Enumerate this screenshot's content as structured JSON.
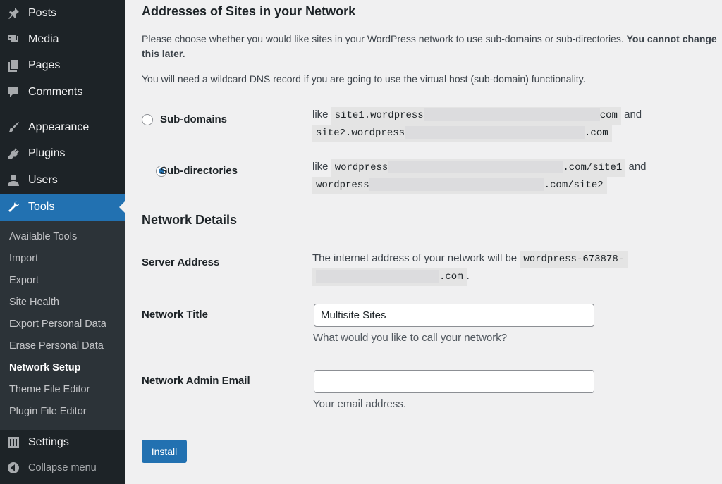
{
  "sidebar": {
    "menu": [
      {
        "label": "Posts",
        "icon": "pushpin-icon"
      },
      {
        "label": "Media",
        "icon": "media-icon"
      },
      {
        "label": "Pages",
        "icon": "pages-icon"
      },
      {
        "label": "Comments",
        "icon": "comment-icon"
      },
      {
        "label": "Appearance",
        "icon": "paintbrush-icon"
      },
      {
        "label": "Plugins",
        "icon": "plug-icon"
      },
      {
        "label": "Users",
        "icon": "user-icon"
      },
      {
        "label": "Tools",
        "icon": "wrench-icon"
      }
    ],
    "submenu": [
      "Available Tools",
      "Import",
      "Export",
      "Site Health",
      "Export Personal Data",
      "Erase Personal Data",
      "Network Setup",
      "Theme File Editor",
      "Plugin File Editor"
    ],
    "settings": {
      "label": "Settings",
      "icon": "sliders-icon"
    },
    "collapse": {
      "label": "Collapse menu",
      "icon": "collapse-icon"
    },
    "active_item": "Tools",
    "current_subitem": "Network Setup"
  },
  "main": {
    "addresses_heading": "Addresses of Sites in your Network",
    "intro_text": "Please choose whether you would like sites in your WordPress network to use sub-domains or sub-directories.",
    "intro_bold": "You cannot change this later.",
    "dns_text": "You will need a wildcard DNS record if you are going to use the virtual host (sub-domain) functionality.",
    "subdomains": {
      "label": "Sub-domains",
      "like": "like",
      "code1_start": "site1.wordpress",
      "code1_end": "com",
      "and": "and",
      "code2_start": "site2.wordpress",
      "code2_end": ".com",
      "checked": false
    },
    "subdirectories": {
      "label": "Sub-directories",
      "like": "like",
      "code1_start": "wordpress",
      "code1_end": ".com/site1",
      "and": "and",
      "code2_start": "wordpress",
      "code2_end": ".com/site2",
      "checked": true
    },
    "details_heading": "Network Details",
    "server_address": {
      "label": "Server Address",
      "text": "The internet address of your network will be",
      "code_start": "wordpress-673878-",
      "code_end": ".com",
      "period": "."
    },
    "network_title": {
      "label": "Network Title",
      "value": "Multisite Sites",
      "help": "What would you like to call your network?"
    },
    "admin_email": {
      "label": "Network Admin Email",
      "value": "",
      "help": "Your email address."
    },
    "install_button": "Install"
  },
  "colors": {
    "sidebar_bg": "#1d2327",
    "submenu_bg": "#2c3338",
    "accent": "#2271b1",
    "content_bg": "#f0f0f1"
  }
}
